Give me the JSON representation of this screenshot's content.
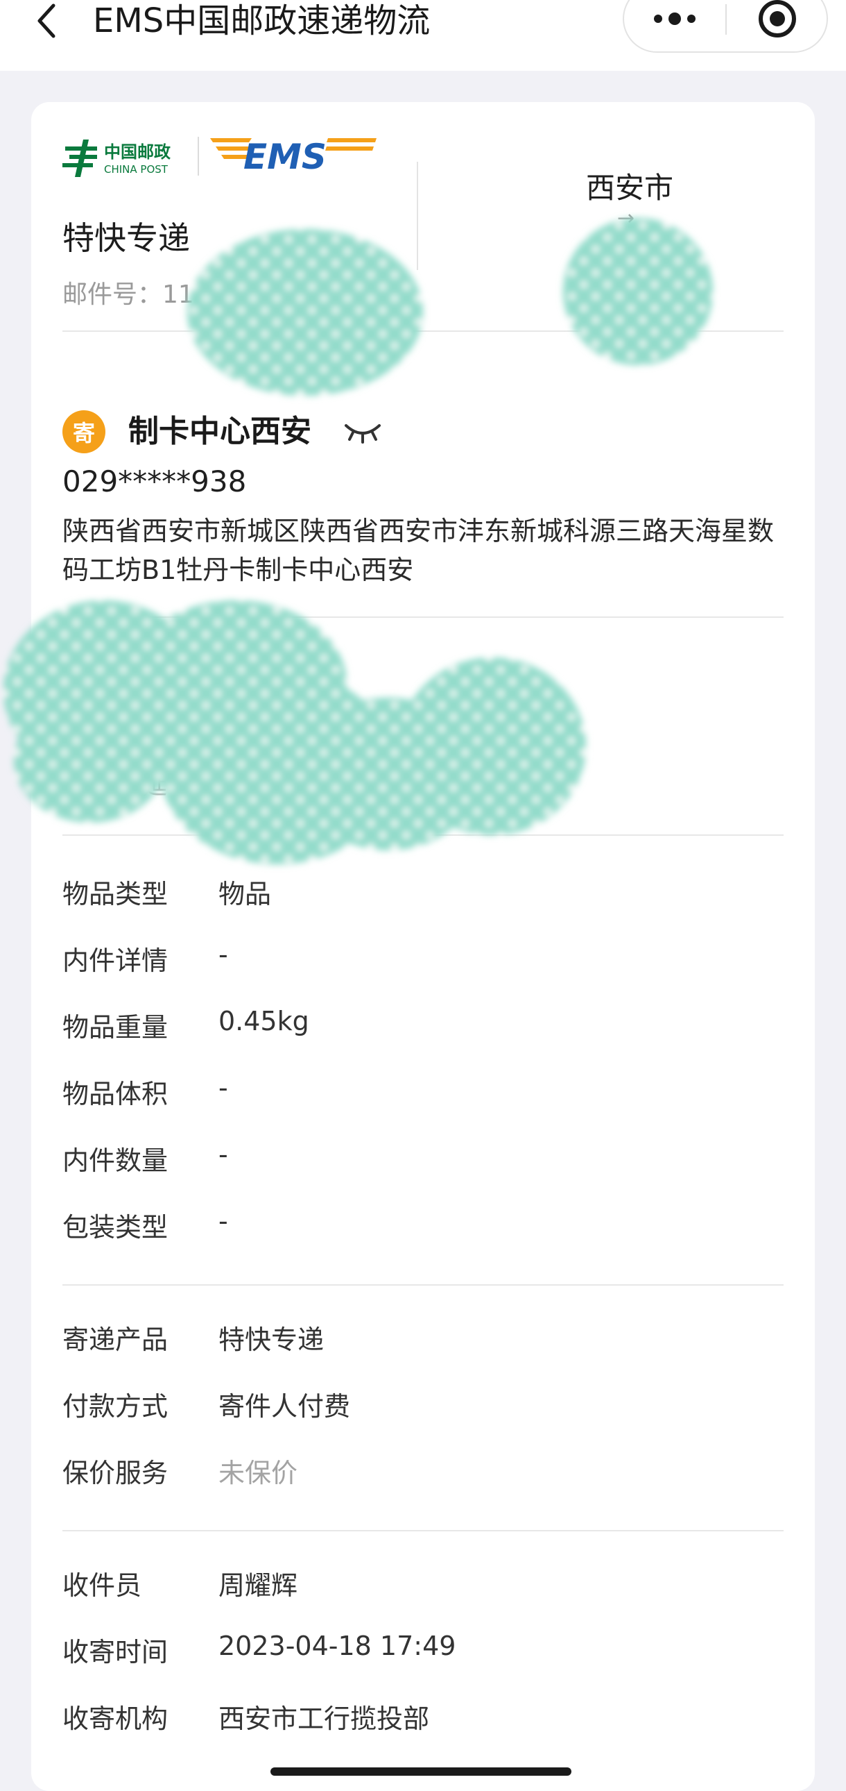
{
  "nav": {
    "title": "EMS中国邮政速递物流",
    "back_icon": "chevron-left-icon",
    "more_icon": "more-dots-icon",
    "target_icon": "target-circle-icon"
  },
  "card": {
    "logo": {
      "post_cn": "中国邮政",
      "post_en": "CHINA POST",
      "ems": "EMS"
    },
    "product_name": "特快专递",
    "mail_no": "邮件号：11",
    "dest_city": "西安市",
    "arrow": "→",
    "sender": {
      "badge": "寄",
      "name": "制卡中心西安",
      "phone": "029*****938",
      "address": "陕西省西安市新城区陕西省西安市沣东新城科源三路天海星数码工坊B1牡丹卡制卡中心西安"
    },
    "delivery_partial": "延",
    "item_details": [
      {
        "label": "物品类型",
        "value": "物品"
      },
      {
        "label": "内件详情",
        "value": "-"
      },
      {
        "label": "物品重量",
        "value": "0.45kg"
      },
      {
        "label": "物品体积",
        "value": "-"
      },
      {
        "label": "内件数量",
        "value": "-"
      },
      {
        "label": "包装类型",
        "value": "-"
      }
    ],
    "service": [
      {
        "label": "寄递产品",
        "value": "特快专递"
      },
      {
        "label": "付款方式",
        "value": "寄件人付费"
      },
      {
        "label": "保价服务",
        "value": "未保价"
      }
    ],
    "collection": [
      {
        "label": "收件员",
        "value": "周耀辉"
      },
      {
        "label": "收寄时间",
        "value": "2023-04-18 17:49"
      },
      {
        "label": "收寄机构",
        "value": "西安市工行揽投部"
      }
    ]
  },
  "colors": {
    "ems_orange": "#f5a019",
    "ems_blue": "#1f5fb4",
    "post_green": "#0a7a3d",
    "blob_teal": "#8fd8c8"
  }
}
